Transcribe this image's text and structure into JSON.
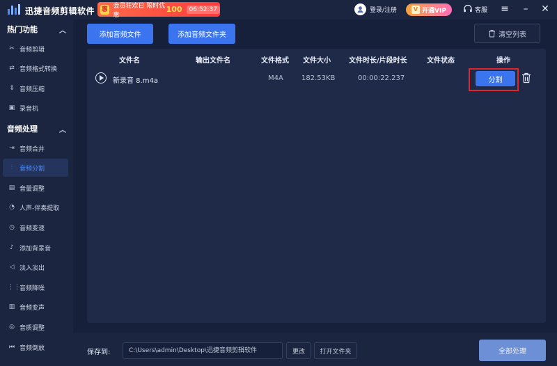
{
  "app": {
    "title": "迅捷音频剪辑软件"
  },
  "promo": {
    "icon_text": "惠",
    "text": "会员狂欢日 限时优惠",
    "number": "100",
    "timer": "06:52:37"
  },
  "header": {
    "login_label": "登录/注册",
    "vip_label": "开通VIP",
    "vip_badge": "V",
    "service_label": "客服"
  },
  "sidebar": {
    "sections": [
      {
        "title": "热门功能",
        "items": [
          {
            "label": "音频剪辑",
            "icon": "scissors-icon"
          },
          {
            "label": "音频格式转换",
            "icon": "convert-icon"
          },
          {
            "label": "音频压缩",
            "icon": "compress-icon"
          },
          {
            "label": "录音机",
            "icon": "recorder-icon"
          }
        ]
      },
      {
        "title": "音频处理",
        "items": [
          {
            "label": "音频合并",
            "icon": "merge-icon"
          },
          {
            "label": "音频分割",
            "icon": "split-icon",
            "active": true
          },
          {
            "label": "音量调整",
            "icon": "volume-icon"
          },
          {
            "label": "人声-伴奏提取",
            "icon": "voice-icon"
          },
          {
            "label": "音频变速",
            "icon": "speed-icon"
          },
          {
            "label": "添加背景音",
            "icon": "music-icon"
          },
          {
            "label": "淡入淡出",
            "icon": "fade-icon"
          },
          {
            "label": "音频降噪",
            "icon": "denoise-icon"
          },
          {
            "label": "音频变声",
            "icon": "voice-change-icon"
          },
          {
            "label": "音质调整",
            "icon": "quality-icon"
          },
          {
            "label": "音频倒放",
            "icon": "reverse-icon"
          }
        ]
      }
    ]
  },
  "toolbar": {
    "add_file": "添加音频文件",
    "add_folder": "添加音频文件夹",
    "clear_list": "清空列表"
  },
  "table": {
    "columns": [
      "文件名",
      "输出文件名",
      "文件格式",
      "文件大小",
      "文件时长/片段时长",
      "文件状态",
      "操作"
    ],
    "rows": [
      {
        "filename": "新录音 8.m4a",
        "output_name": "",
        "format": "M4A",
        "size": "182.53KB",
        "duration": "00:00:22.237",
        "status": "",
        "action_label": "分割"
      }
    ]
  },
  "bottom": {
    "save_label": "保存到:",
    "path": "C:\\Users\\admin\\Desktop\\迅捷音频剪辑软件",
    "change_label": "更改",
    "open_folder_label": "打开文件夹",
    "process_all_label": "全部处理"
  }
}
